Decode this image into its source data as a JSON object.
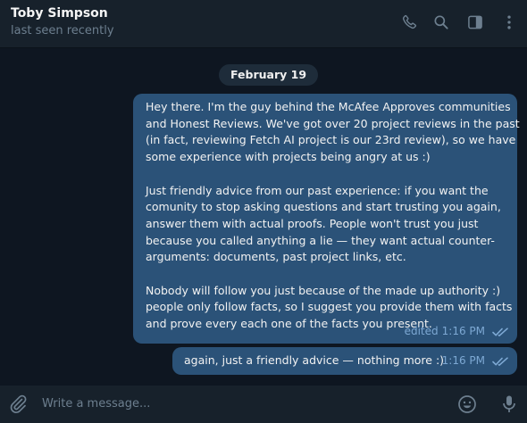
{
  "header": {
    "contact_name": "Toby Simpson",
    "status": "last seen recently",
    "icons": [
      "phone-icon",
      "search-icon",
      "sidebar-toggle-icon",
      "more-icon"
    ]
  },
  "date_separator": "February 19",
  "messages": [
    {
      "lines": [
        "Hey there. I'm the guy behind the McAfee Approves communities",
        "and Honest Reviews. We've got over 20 project reviews in the past",
        "(in fact, reviewing Fetch AI project is our 23rd review), so we have",
        "some experience with projects being angry at us :)",
        "",
        "Just friendly advice from our past experience: if you want the",
        "comunity to stop asking questions and start trusting you again,",
        "answer them with actual proofs. People won't trust you just",
        "because you called anything a lie — they want actual counter-",
        "arguments: documents, past project links, etc.",
        "",
        "Nobody will follow you just because of the made up authority :)",
        "people only follow facts, so I suggest you provide them with facts",
        "and prove every each one of the facts you present."
      ],
      "edited_label": "edited",
      "time": "1:16 PM",
      "read": true
    },
    {
      "text": "again, just a friendly advice — nothing more :)",
      "time": "1:16 PM",
      "read": true
    }
  ],
  "composer": {
    "placeholder": "Write a message..."
  },
  "colors": {
    "background": "#0e1621",
    "panel": "#17212b",
    "outgoing_bubble": "#2b5278",
    "meta_text": "#7da8d3",
    "muted_text": "#6d7f8f"
  }
}
